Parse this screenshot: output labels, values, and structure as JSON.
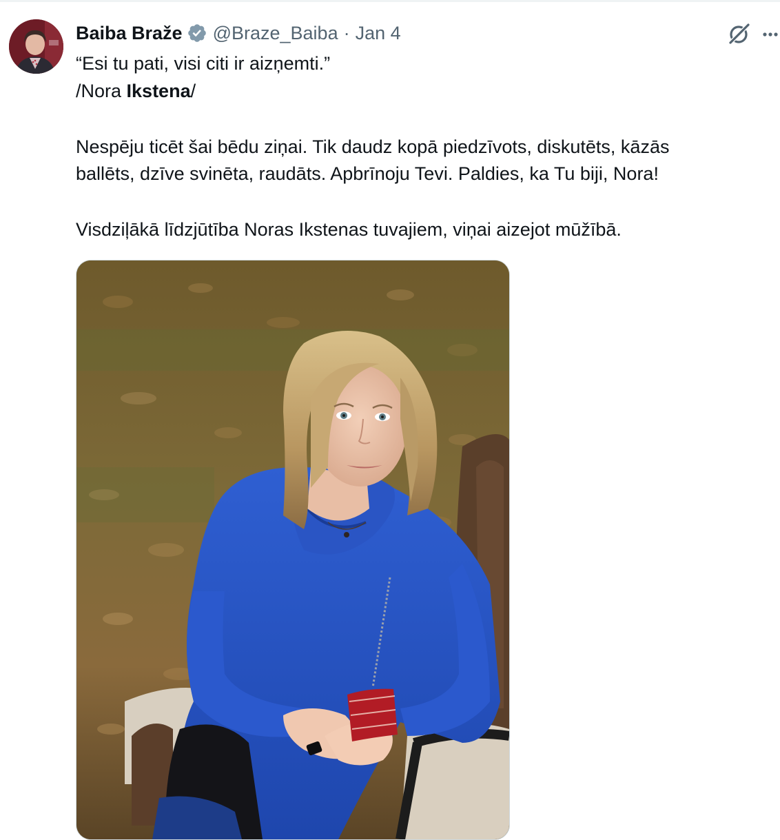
{
  "tweet": {
    "author": {
      "display_name": "Baiba Braže",
      "handle": "@Braze_Baiba",
      "verified": true
    },
    "separator": "·",
    "date": "Jan 4",
    "header_icons": [
      "grok-icon",
      "more-icon"
    ],
    "text": {
      "line1": "“Esi tu pati, visi citi ir aizņemti.”",
      "line2_prefix": "/Nora ",
      "line2_bold": "Ikstena",
      "line2_suffix": "/",
      "line3": "Nespēju ticēt šai bēdu ziņai. Tik daudz kopā piedzīvots, diskutēts, kāzās",
      "line4": "ballēts, dzīve svinēta, raudāts. Apbrīnoju Tevi. Paldies, ka Tu biji, Nora!",
      "line5": "Visdziļākā līdzjūtība Noras Ikstenas tuvajiem, viņai aizejot mūžībā."
    },
    "media": {
      "type": "photo"
    },
    "colors": {
      "text": "#0f1419",
      "secondary": "#536471",
      "verified_badge": "#829aab"
    }
  }
}
